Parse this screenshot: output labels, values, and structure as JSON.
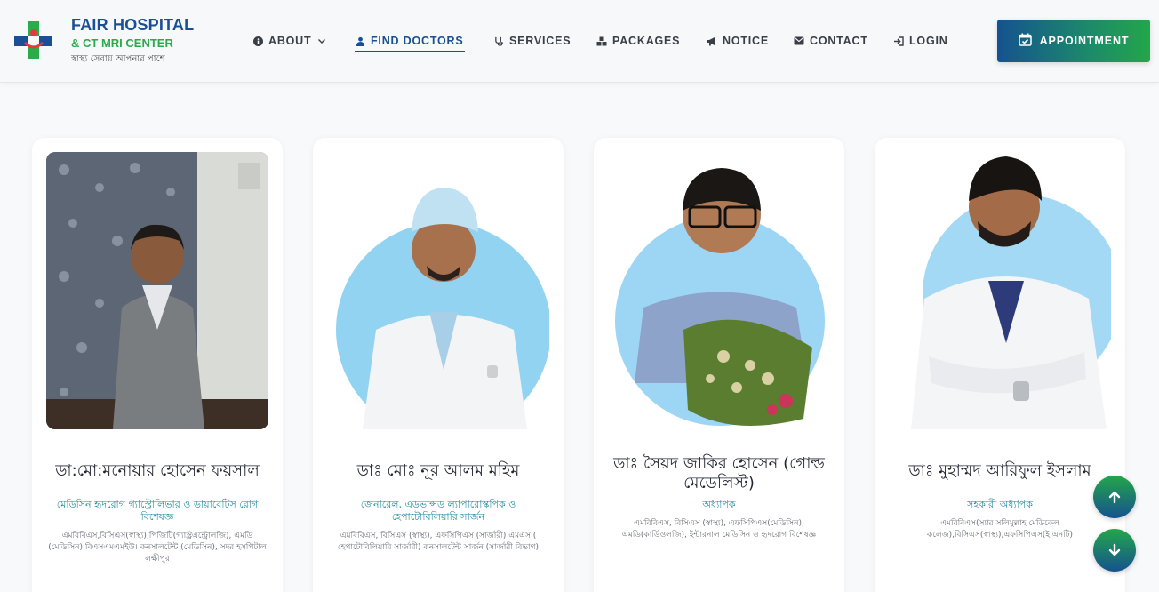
{
  "brand": {
    "title": "FAIR HOSPITAL",
    "subtitle": "& CT MRI CENTER",
    "tagline": "স্বাস্থ্য সেবায় আপনার পাশে"
  },
  "nav": {
    "items": [
      {
        "label": "ABOUT",
        "icon": "info-icon"
      },
      {
        "label": "FIND DOCTORS",
        "icon": "user-icon"
      },
      {
        "label": "SERVICES",
        "icon": "stethoscope-icon"
      },
      {
        "label": "PACKAGES",
        "icon": "boxes-icon"
      },
      {
        "label": "NOTICE",
        "icon": "megaphone-icon"
      },
      {
        "label": "CONTACT",
        "icon": "envelope-icon"
      },
      {
        "label": "LOGIN",
        "icon": "sign-in-icon"
      }
    ],
    "appointment": "APPOINTMENT"
  },
  "doctors": [
    {
      "name": "ডা:মো:মনোয়ার হোসেন ফয়সাল",
      "specialty": "মেডিসিন হৃদরোগ গ্যাস্ট্রোলিভার ও ডায়াবেটিস রোগ বিশেষজ্ঞ",
      "qualification": "এমবিবিএস,বিসিএস(স্বাস্থ্য),পিজিটি(গ্যাস্ট্রএন্ট্রোলজি), এমডি (মেডিসিন) বিএসএমএমইউ। কনসালটেন্ট (মেডিসিন), সদর হসপিটাল লক্ষীপুর"
    },
    {
      "name": "ডাঃ মোঃ নূর আলম মহিম",
      "specialty": "জেনারেল, এডভান্সড ল্যাপারোস্কপিক ও হেপাটোবিলিয়ারি সার্জন",
      "qualification": "এমবিবিএস, বিসিএস (স্বাস্থ্য), এফসিপিএস (সার্জারী) এমএস ( হেপাটোবিলিয়ারি সার্জারী) কনসালটেন্ট সার্জন (সার্জারী বিভাগ)"
    },
    {
      "name": "ডাঃ সৈয়দ জাকির হোসেন (গোল্ড মেডেলিস্ট)",
      "specialty": "অধ্যাপক",
      "qualification": "এমবিবিএস, বিসিএস (স্বাস্থ্য), এফসিপিএস(মেডিসিন), এমডি(কার্ডিওলজি), ইন্টারনাল মেডিসিন ও হৃদরোগ বিশেষজ্ঞ"
    },
    {
      "name": "ডাঃ মুহাম্মদ আরিফুল ইসলাম",
      "specialty": "সহকারী অধ্যাপক",
      "qualification": "এমবিবিএস(স্যার সলিমুল্লাহ মেডিকেল কলেজ),বিসিএস(স্বাস্থ্য),এফসিপিএস(ই.এনটি)"
    }
  ],
  "colors": {
    "brand_blue": "#1b4f93",
    "brand_green": "#2bab4a",
    "specialty_teal": "#1f8aa0"
  }
}
